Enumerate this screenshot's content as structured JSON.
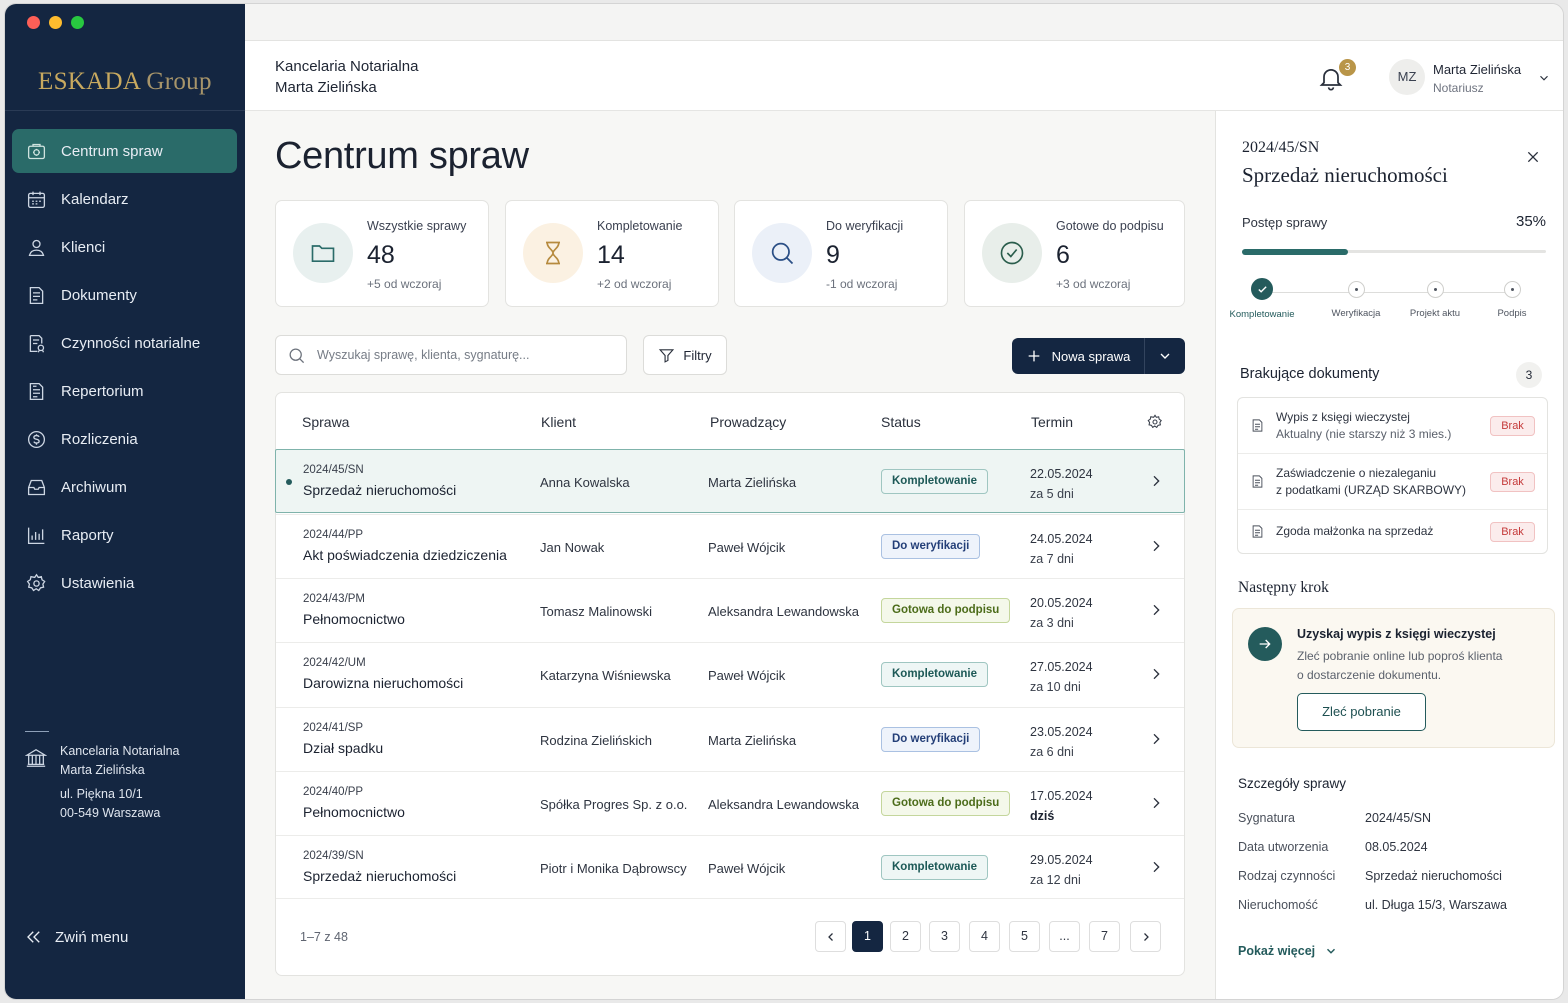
{
  "app": {
    "logo_main": "ESKADA",
    "logo_sub": " Group"
  },
  "colors": {
    "sidebar": "#142641",
    "accent": "#2a6b69",
    "gold": "#c8a95f",
    "danger": "#c53b3b"
  },
  "sidebar": {
    "items": [
      {
        "label": "Centrum spraw",
        "icon": "cases-icon",
        "active": true
      },
      {
        "label": "Kalendarz",
        "icon": "calendar-icon"
      },
      {
        "label": "Klienci",
        "icon": "user-icon"
      },
      {
        "label": "Dokumenty",
        "icon": "document-icon"
      },
      {
        "label": "Czynności notarialne",
        "icon": "notarial-icon"
      },
      {
        "label": "Repertorium",
        "icon": "register-icon"
      },
      {
        "label": "Rozliczenia",
        "icon": "billing-icon"
      },
      {
        "label": "Archiwum",
        "icon": "archive-icon"
      },
      {
        "label": "Raporty",
        "icon": "reports-icon"
      },
      {
        "label": "Ustawienia",
        "icon": "settings-icon"
      }
    ],
    "office": {
      "line1": "Kancelaria Notarialna",
      "line2": "Marta Zielińska",
      "addr1": "ul. Piękna 10/1",
      "addr2": "00-549 Warszawa"
    },
    "collapse_label": "Zwiń menu"
  },
  "header": {
    "firm_line1": "Kancelaria Notarialna",
    "firm_line2": "Marta Zielińska",
    "notifications": "3",
    "avatar_initials": "MZ",
    "user_name": "Marta Zielińska",
    "user_role": "Notariusz"
  },
  "page": {
    "title": "Centrum spraw"
  },
  "stats": [
    {
      "label": "Wszystkie sprawy",
      "value": "48",
      "delta": "+5 od wczoraj",
      "icon": "folder-icon"
    },
    {
      "label": "Kompletowanie",
      "value": "14",
      "delta": "+2 od wczoraj",
      "icon": "hourglass-icon"
    },
    {
      "label": "Do weryfikacji",
      "value": "9",
      "delta": "-1 od wczoraj",
      "icon": "magnifier-icon"
    },
    {
      "label": "Gotowe do podpisu",
      "value": "6",
      "delta": "+3 od wczoraj",
      "icon": "check-circle-icon"
    }
  ],
  "toolbar": {
    "search_placeholder": "Wyszukaj sprawę, klienta, sygnaturę...",
    "filters_label": "Filtry",
    "new_label": "Nowa sprawa"
  },
  "table": {
    "columns": [
      "Sprawa",
      "Klient",
      "Prowadzący",
      "Status",
      "Termin"
    ],
    "rows": [
      {
        "sig": "2024/45/SN",
        "title": "Sprzedaż nieruchomości",
        "client": "Anna Kowalska",
        "lead": "Marta Zielińska",
        "status": "Kompletowanie",
        "date": "22.05.2024",
        "rel": "za 5 dni"
      },
      {
        "sig": "2024/44/PP",
        "title": "Akt poświadczenia dziedziczenia",
        "client": "Jan Nowak",
        "lead": "Paweł Wójcik",
        "status": "Do weryfikacji",
        "date": "24.05.2024",
        "rel": "za 7 dni"
      },
      {
        "sig": "2024/43/PM",
        "title": "Pełnomocnictwo",
        "client": "Tomasz Malinowski",
        "lead": "Aleksandra Lewandowska",
        "status": "Gotowa do podpisu",
        "date": "20.05.2024",
        "rel": "za 3 dni"
      },
      {
        "sig": "2024/42/UM",
        "title": "Darowizna nieruchomości",
        "client": "Katarzyna Wiśniewska",
        "lead": "Paweł Wójcik",
        "status": "Kompletowanie",
        "date": "27.05.2024",
        "rel": "za 10 dni"
      },
      {
        "sig": "2024/41/SP",
        "title": "Dział spadku",
        "client": "Rodzina Zielińskich",
        "lead": "Marta Zielińska",
        "status": "Do weryfikacji",
        "date": "23.05.2024",
        "rel": "za 6 dni"
      },
      {
        "sig": "2024/40/PP",
        "title": "Pełnomocnictwo",
        "client": "Spółka Progres Sp. z o.o.",
        "lead": "Aleksandra Lewandowska",
        "status": "Gotowa do podpisu",
        "date": "17.05.2024",
        "rel": "dziś"
      },
      {
        "sig": "2024/39/SN",
        "title": "Sprzedaż nieruchomości",
        "client": "Piotr i Monika Dąbrowscy",
        "lead": "Paweł Wójcik",
        "status": "Kompletowanie",
        "date": "29.05.2024",
        "rel": "za 12 dni"
      }
    ],
    "range_text": "1–7 z 48",
    "pages": [
      "1",
      "2",
      "3",
      "4",
      "5",
      "...",
      "7"
    ]
  },
  "panel": {
    "sig": "2024/45/SN",
    "title": "Sprzedaż nieruchomości",
    "progress_label": "Postęp sprawy",
    "progress_text": "35%",
    "progress": 0.35,
    "steps": [
      "Kompletowanie",
      "Weryfikacja",
      "Projekt aktu",
      "Podpis"
    ],
    "missing_title": "Brakujące dokumenty",
    "missing_count": "3",
    "missing": [
      {
        "l1": "Wypis z księgi wieczystej",
        "l2": "Aktualny (nie starszy niż 3 mies.)",
        "tag": "Brak"
      },
      {
        "l1": "Zaświadczenie o niezaleganiu",
        "l2": "z podatkami (URZĄD SKARBOWY)",
        "tag": "Brak"
      },
      {
        "l1": "Zgoda małżonka na sprzedaż",
        "l2": "",
        "tag": "Brak"
      }
    ],
    "next_title": "Następny krok",
    "next_action": "Uzyskaj wypis z księgi wieczystej",
    "next_desc1": "Zleć pobranie online lub poproś klienta",
    "next_desc2": "o dostarczenie dokumentu.",
    "next_button": "Zleć pobranie",
    "details_title": "Szczegóły sprawy",
    "details": [
      {
        "k": "Sygnatura",
        "v": "2024/45/SN"
      },
      {
        "k": "Data utworzenia",
        "v": "08.05.2024"
      },
      {
        "k": "Rodzaj czynności",
        "v": "Sprzedaż nieruchomości"
      },
      {
        "k": "Nieruchomość",
        "v": "ul. Długa 15/3, Warszawa"
      }
    ],
    "more_label": "Pokaż więcej"
  }
}
